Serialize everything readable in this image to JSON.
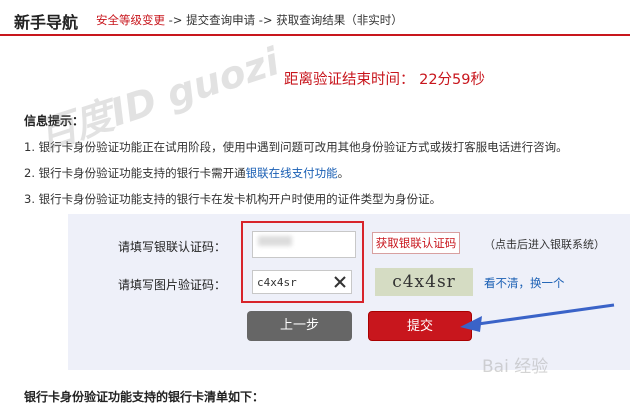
{
  "nav": {
    "title": "新手导航",
    "step_active": "安全等级变更",
    "steps_rest": " -> 提交查询申请 -> 获取查询结果（非实时）"
  },
  "countdown": "距离验证结束时间： 22分59秒",
  "info": {
    "title": "信息提示：",
    "item1": "1. 银行卡身份验证功能正在试用阶段，使用中遇到问题可改用其他身份验证方式或拨打客服电话进行咨询。",
    "item2_pre": "2. 银行卡身份验证功能支持的银行卡需开通",
    "item2_link": "银联在线支付功能",
    "item2_post": "。",
    "item3": "3. 银行卡身份验证功能支持的银行卡在发卡机构开户时使用的证件类型为身份证。"
  },
  "form": {
    "sms_label": "请填写银联认证码：",
    "captcha_label": "请填写图片验证码：",
    "captcha_value": "c4x4sr",
    "get_code_button": "获取银联认证码",
    "get_code_hint": "（点击后进入银联系统）",
    "captcha_image_text": "c4x4sr",
    "refresh_link": "看不清，换一个",
    "back_button": "上一步",
    "submit_button": "提交"
  },
  "bottom_title": "银行卡身份验证功能支持的银行卡清单如下：",
  "watermark": "百度ID guozi",
  "watermark_logo": "Bai 经验",
  "colors": {
    "brand_red": "#c8161d",
    "link_blue": "#1a5fb4",
    "panel_bg": "#eef0f9"
  }
}
